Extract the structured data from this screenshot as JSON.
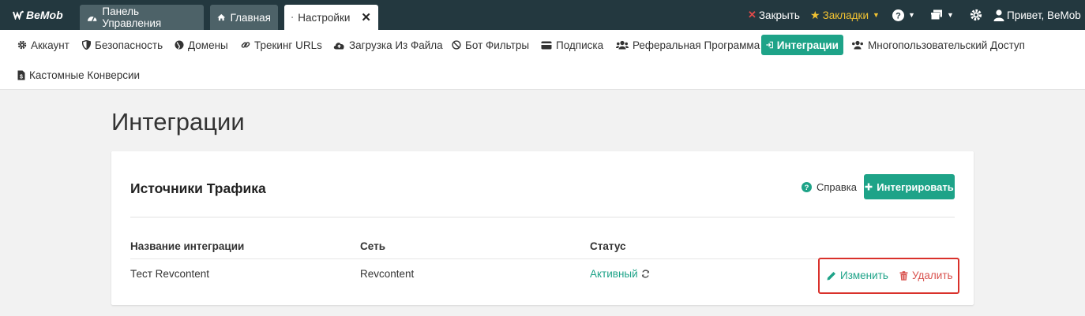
{
  "app": {
    "logo": "BeMob"
  },
  "tabs": [
    {
      "label": "Панель Управления",
      "icon": "dashboard-icon"
    },
    {
      "label": "Главная",
      "icon": "home-icon"
    },
    {
      "label": "Настройки",
      "icon": "gear-icon",
      "active": true,
      "close": "✕"
    }
  ],
  "topright": {
    "close": "Закрыть",
    "bookmarks": "Закладки",
    "greeting": "Привет, BeMob"
  },
  "subnav": [
    {
      "label": "Аккаунт",
      "icon": "gear-icon"
    },
    {
      "label": "Безопасность",
      "icon": "shield-icon"
    },
    {
      "label": "Домены",
      "icon": "globe-icon"
    },
    {
      "label": "Трекинг URLs",
      "icon": "link-icon"
    },
    {
      "label": "Загрузка Из Файла",
      "icon": "cloud-upload-icon"
    },
    {
      "label": "Бот Фильтры",
      "icon": "ban-icon"
    },
    {
      "label": "Подписка",
      "icon": "credit-card-icon"
    },
    {
      "label": "Реферальная Программа",
      "icon": "users-icon"
    },
    {
      "label": "Интеграции",
      "icon": "sign-in-icon",
      "active": true
    },
    {
      "label": "Многопользовательский Доступ",
      "icon": "user-group-icon"
    },
    {
      "label": "Кастомные Конверсии",
      "icon": "file-dollar-icon"
    }
  ],
  "page": {
    "title": "Интеграции"
  },
  "card": {
    "title": "Источники Трафика",
    "help": "Справка",
    "integrate": "Интегрировать",
    "columns": [
      "Название интеграции",
      "Сеть",
      "Статус"
    ],
    "rows": [
      {
        "name": "Тест Revcontent",
        "network": "Revcontent",
        "status": "Активный",
        "edit": "Изменить",
        "delete": "Удалить"
      }
    ]
  },
  "colors": {
    "topbar": "#23383f",
    "accent": "#1ea388",
    "danger": "#d9534f",
    "bookmarks": "#f1c232"
  }
}
